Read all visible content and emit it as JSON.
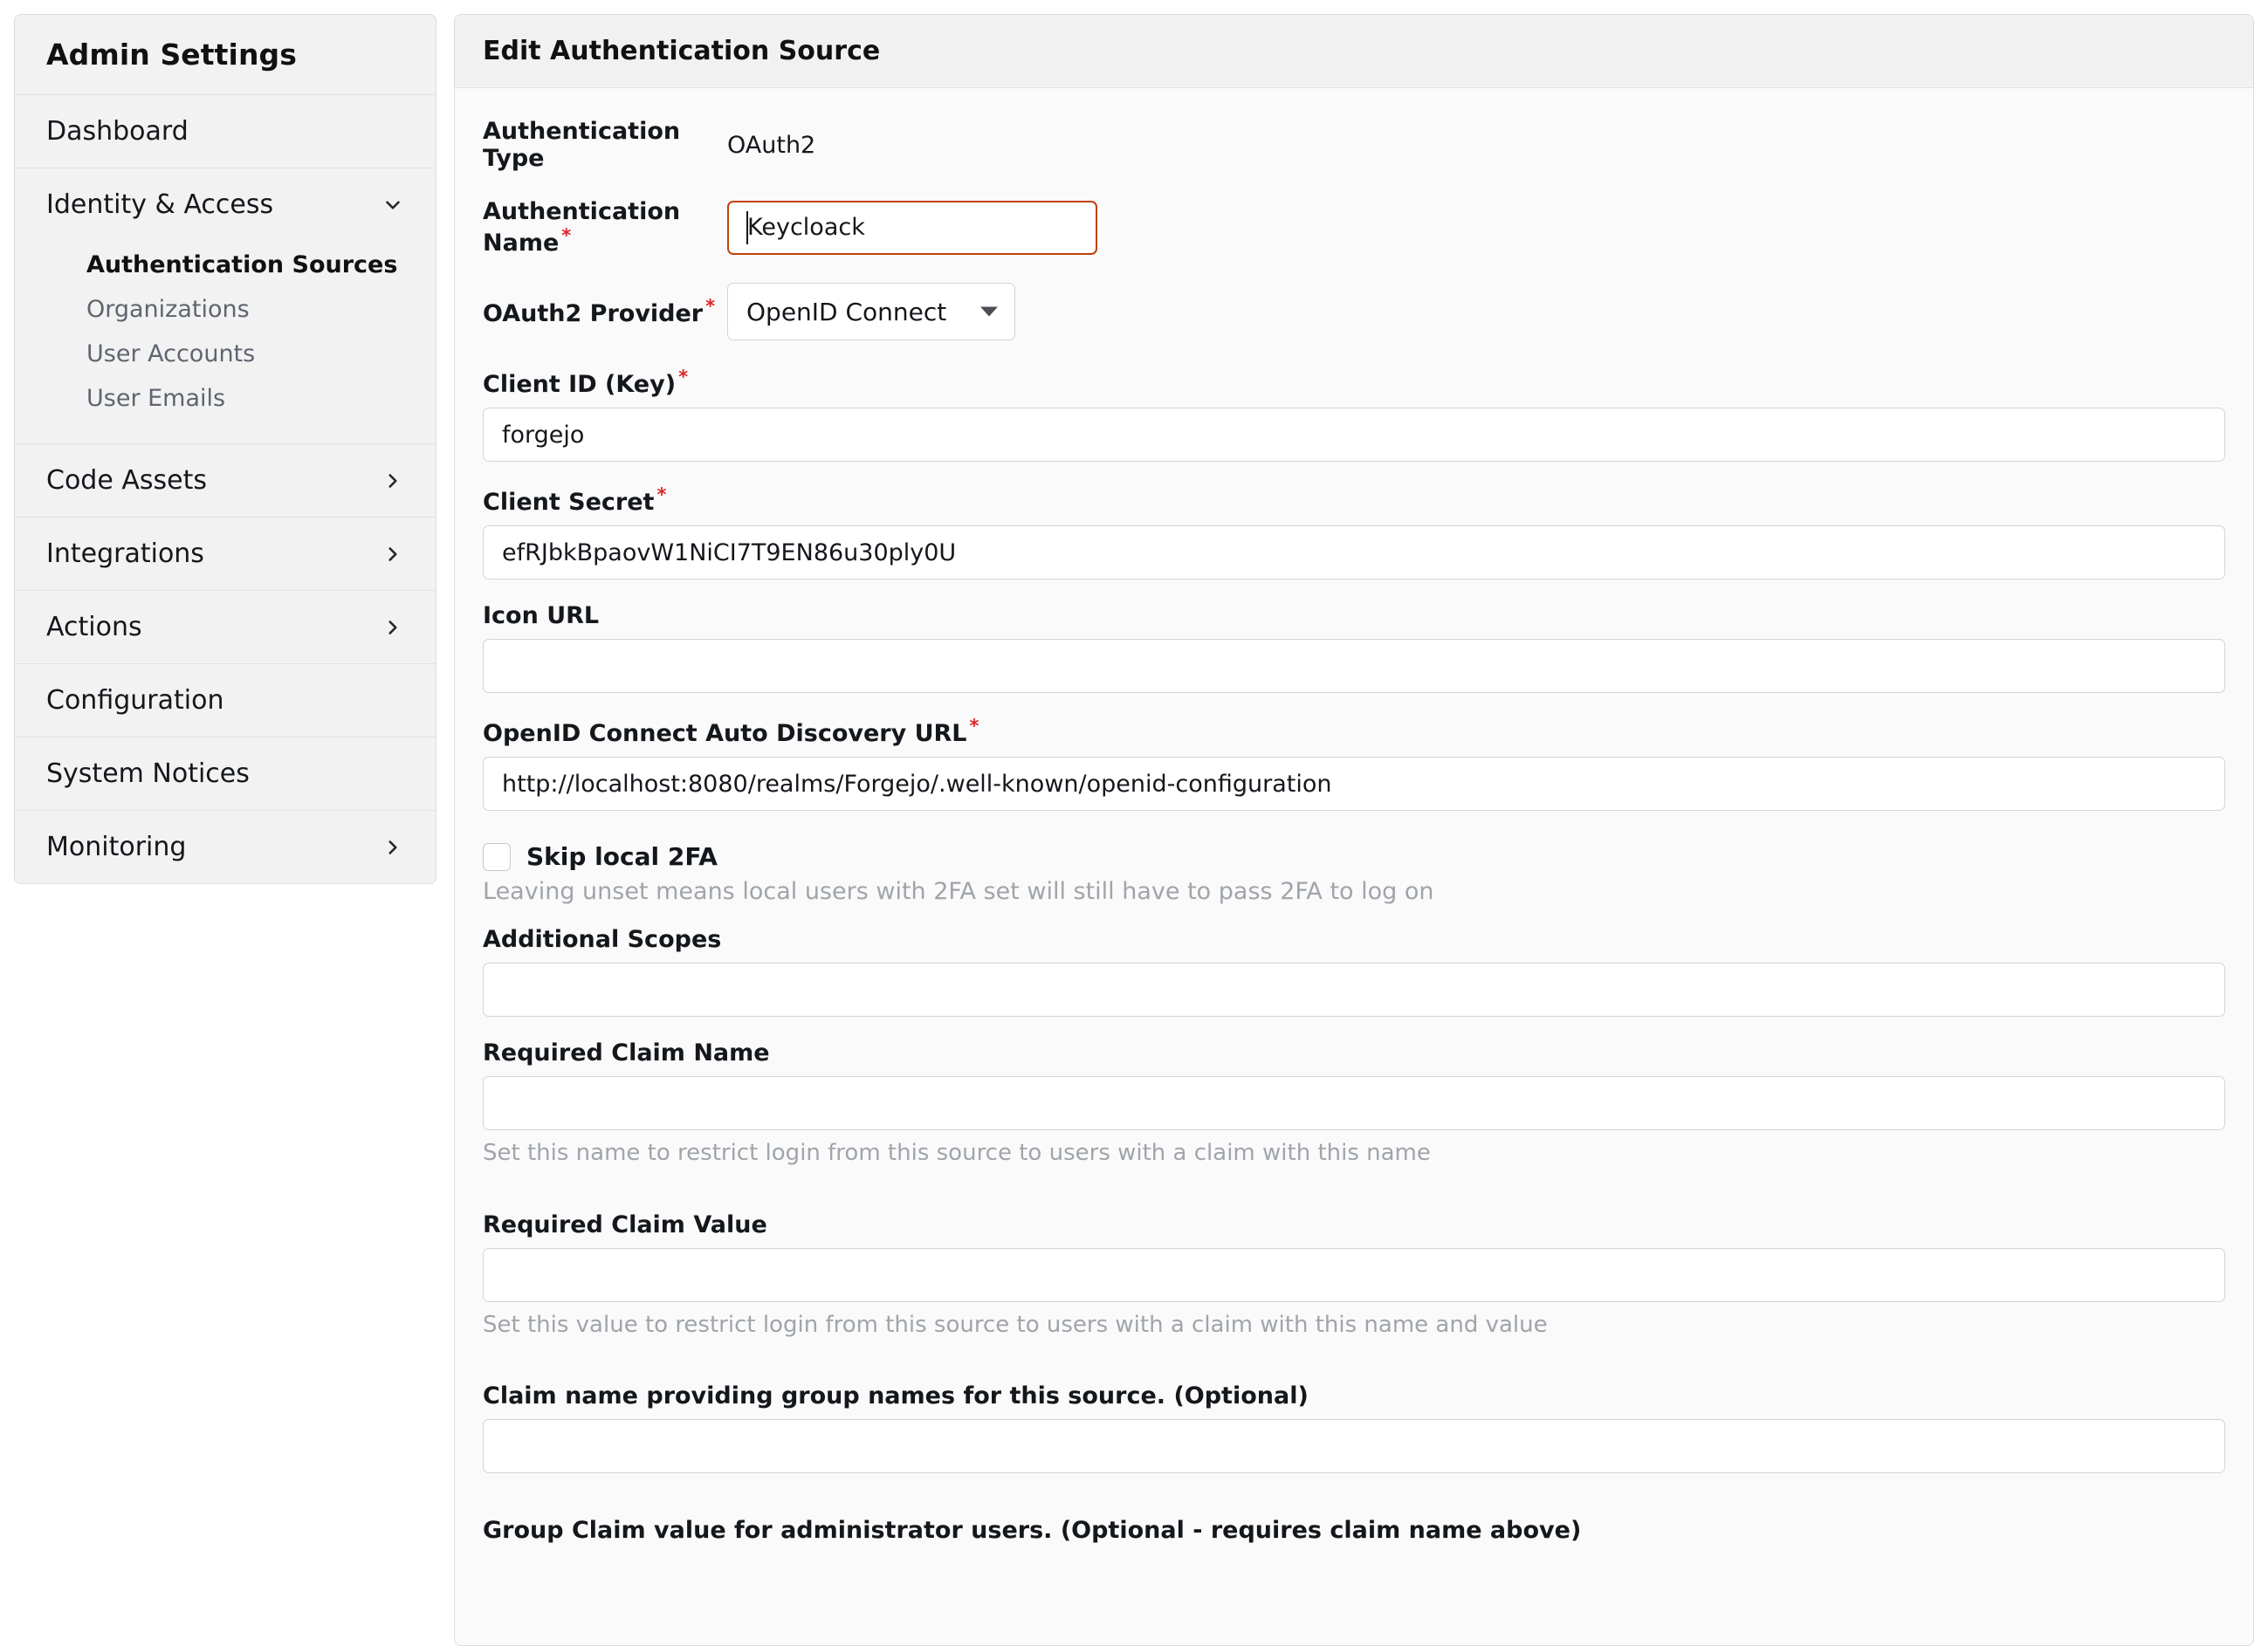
{
  "sidebar": {
    "title": "Admin Settings",
    "items": [
      {
        "label": "Dashboard",
        "expandable": false,
        "icon": ""
      },
      {
        "label": "Identity & Access",
        "expandable": true,
        "icon": "chevron-down-icon"
      },
      {
        "label": "Code Assets",
        "expandable": true,
        "icon": "chevron-right-icon"
      },
      {
        "label": "Integrations",
        "expandable": true,
        "icon": "chevron-right-icon"
      },
      {
        "label": "Actions",
        "expandable": true,
        "icon": "chevron-right-icon"
      },
      {
        "label": "Configuration",
        "expandable": false,
        "icon": ""
      },
      {
        "label": "System Notices",
        "expandable": false,
        "icon": ""
      },
      {
        "label": "Monitoring",
        "expandable": true,
        "icon": "chevron-right-icon"
      }
    ],
    "subitems": [
      {
        "label": "Authentication Sources",
        "active": true
      },
      {
        "label": "Organizations",
        "active": false
      },
      {
        "label": "User Accounts",
        "active": false
      },
      {
        "label": "User Emails",
        "active": false
      }
    ]
  },
  "panel": {
    "header": "Edit Authentication Source"
  },
  "form": {
    "auth_type_label": "Authentication Type",
    "auth_type_value": "OAuth2",
    "auth_name_label": "Authentication Name",
    "auth_name_value": "Keycloack",
    "auth_name_placeholder": "",
    "provider_label": "OAuth2 Provider",
    "provider_value": "OpenID Connect",
    "provider_options": [
      "OpenID Connect"
    ],
    "client_id_label": "Client ID (Key)",
    "client_id_value": "forgejo",
    "client_id_placeholder": "",
    "client_secret_label": "Client Secret",
    "client_secret_value": "efRJbkBpaovW1NiCI7T9EN86u30ply0U",
    "client_secret_placeholder": "",
    "icon_url_label": "Icon URL",
    "icon_url_value": "",
    "icon_url_placeholder": "",
    "discovery_label": "OpenID Connect Auto Discovery URL",
    "discovery_value": "http://localhost:8080/realms/Forgejo/.well-known/openid-configuration",
    "discovery_placeholder": "",
    "skip_2fa_label": "Skip local 2FA",
    "skip_2fa_hint": "Leaving unset means local users with 2FA set will still have to pass 2FA to log on",
    "skip_2fa_checked": false,
    "scopes_label": "Additional Scopes",
    "scopes_value": "",
    "scopes_placeholder": "",
    "claim_name_label": "Required Claim Name",
    "claim_name_value": "",
    "claim_name_placeholder": "",
    "claim_name_hint": "Set this name to restrict login from this source to users with a claim with this name",
    "claim_value_label": "Required Claim Value",
    "claim_value_value": "",
    "claim_value_placeholder": "",
    "claim_value_hint": "Set this value to restrict login from this source to users with a claim with this name and value",
    "group_claim_name_label": "Claim name providing group names for this source. (Optional)",
    "group_claim_name_value": "",
    "group_claim_name_placeholder": "",
    "group_admin_label": "Group Claim value for administrator users. (Optional - requires claim name above)",
    "required_marker": "*"
  },
  "colors": {
    "focus_border": "#c2410c",
    "required_star": "#db2828",
    "sidebar_bg": "#f2f2f2",
    "panel_bg": "#fafafa",
    "panel_header_bg": "#f1f1f1"
  }
}
